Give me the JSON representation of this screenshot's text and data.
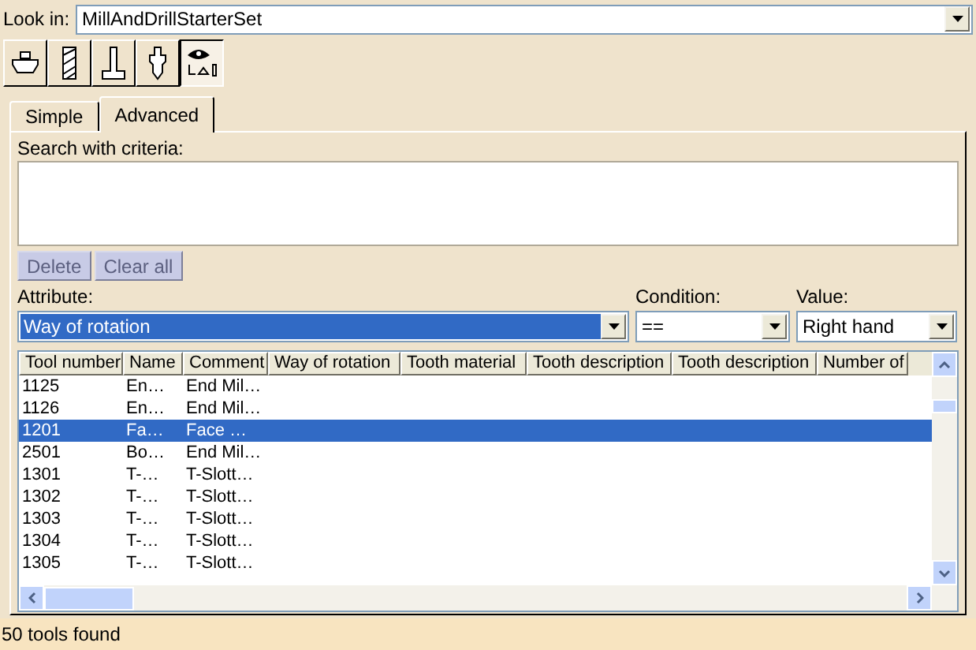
{
  "look_in": {
    "label": "Look in:",
    "value": "MillAndDrillStarterSet"
  },
  "toolbar": [
    {
      "kind": "mill",
      "selected": false
    },
    {
      "kind": "end-mill",
      "selected": false
    },
    {
      "kind": "t-slot",
      "selected": false
    },
    {
      "kind": "drill",
      "selected": false
    },
    {
      "kind": "view-all",
      "selected": true
    }
  ],
  "tabs": [
    {
      "label": "Simple",
      "selected": false
    },
    {
      "label": "Advanced",
      "selected": true
    }
  ],
  "search": {
    "label": "Search with criteria:"
  },
  "buttons": [
    {
      "label": "Delete",
      "disabled": true
    },
    {
      "label": "Clear all",
      "disabled": true
    }
  ],
  "attribute": {
    "label": "Attribute:",
    "value": "Way of rotation"
  },
  "condition": {
    "label": "Condition:",
    "value": "=="
  },
  "value": {
    "label": "Value:",
    "value": "Right hand"
  },
  "table": {
    "columns": [
      "Tool number",
      "Name",
      "Comment",
      "Way of rotation",
      "Tooth material",
      "Tooth description",
      "Tooth description",
      "Number of"
    ],
    "rows": [
      {
        "cells": [
          "1125",
          "En…",
          "End Mil…"
        ],
        "selected": false
      },
      {
        "cells": [
          "1126",
          "En…",
          "End Mil…"
        ],
        "selected": false
      },
      {
        "cells": [
          "1201",
          "Fa…",
          "Face …"
        ],
        "selected": true
      },
      {
        "cells": [
          "2501",
          "Bo…",
          "End Mil…"
        ],
        "selected": false
      },
      {
        "cells": [
          "1301",
          "T-…",
          "T-Slott…"
        ],
        "selected": false
      },
      {
        "cells": [
          "1302",
          "T-…",
          "T-Slott…"
        ],
        "selected": false
      },
      {
        "cells": [
          "1303",
          "T-…",
          "T-Slott…"
        ],
        "selected": false
      },
      {
        "cells": [
          "1304",
          "T-…",
          "T-Slott…"
        ],
        "selected": false
      },
      {
        "cells": [
          "1305",
          "T-…",
          "T-Slott…"
        ],
        "selected": false
      }
    ]
  },
  "status_bar": "50 tools found"
}
